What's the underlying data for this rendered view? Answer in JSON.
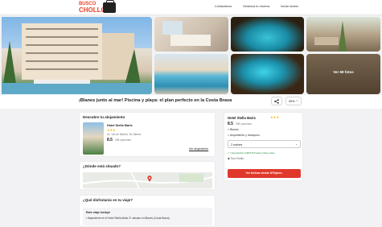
{
  "header": {
    "logo_line1": "BUSCO",
    "logo_line2": "CHOLLO",
    "nav": [
      "Contáctanos",
      "Gestiona tu reserva",
      "Iniciar sesión"
    ]
  },
  "gallery": {
    "more_photos": "Ver 69 fotos"
  },
  "title": "¡Blanes junto al mar! Piscina y playa: el plan perfecto en la Costa Brava",
  "actions": {
    "share_icon": "share-icon",
    "favorite_count": "25%"
  },
  "lodging": {
    "section_title": "Descubre tu alojamiento",
    "hotel_name": "Hotel Stella Maris",
    "stars": "★★★",
    "address": "Av. Vila de Madrid, 18, Blanes",
    "rating": "8.5",
    "reviews": "308 opiniones",
    "link": "Ver alojamiento"
  },
  "location": {
    "section_title": "¿Dónde está situado?"
  },
  "enjoy": {
    "section_title": "¿Qué disfrutarás en tu viaje?",
    "includes_title": "Este viaje incluye",
    "includes_item": "Alojamiento en el Hotel Stella Maris 3* ubicado en Blanes (Costa Brava)"
  },
  "sidebar": {
    "hotel_name": "Hotel Stella Maris",
    "stars": "★★★",
    "rating": "8.5",
    "reviews": "308 opiniones",
    "city": "Blanes",
    "regime": "Alojamiento y desayuno",
    "nights": "2 noches",
    "cancel": "Cancelación GRATIS hasta 3 días antes",
    "provider": "Tour Chollo",
    "cta": "Ver fechas desde 87€/pers."
  }
}
